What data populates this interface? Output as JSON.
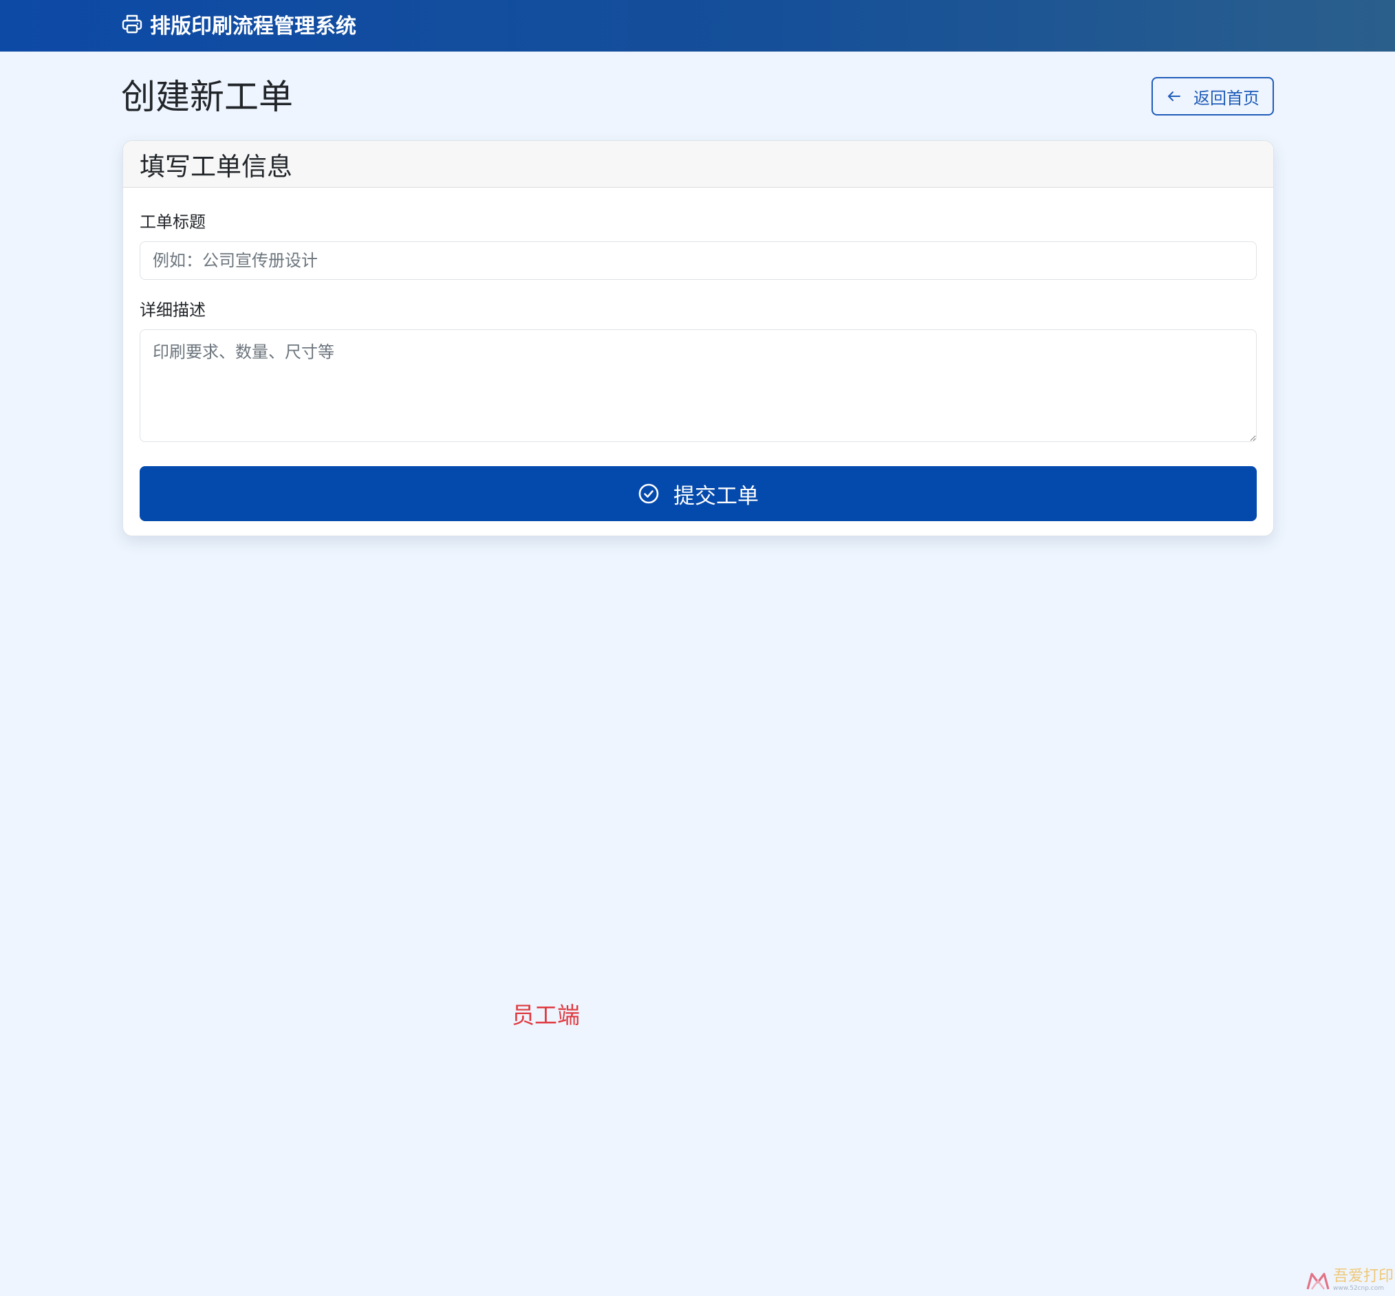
{
  "navbar": {
    "brand": "排版印刷流程管理系统",
    "brand_icon": "printer-icon"
  },
  "page": {
    "title": "创建新工单",
    "back_button": "返回首页",
    "back_icon": "arrow-left-icon"
  },
  "form": {
    "header": "填写工单信息",
    "title_label": "工单标题",
    "title_placeholder": "例如：公司宣传册设计",
    "title_value": "",
    "description_label": "详细描述",
    "description_placeholder": "印刷要求、数量、尺寸等",
    "description_value": "",
    "submit_button": "提交工单",
    "submit_icon": "check-circle-icon"
  },
  "annotation": {
    "text": "员工端",
    "color": "#e0383e"
  },
  "watermark": {
    "text": "吾爱打印",
    "url": "www.52cnp.com",
    "logo_icon": "site-logo-icon"
  },
  "colors": {
    "navbar_start": "#0d4aa6",
    "navbar_end": "#2a5f8c",
    "primary": "#0449ac",
    "outline": "#1e5bb8",
    "background": "#eef5fe"
  }
}
